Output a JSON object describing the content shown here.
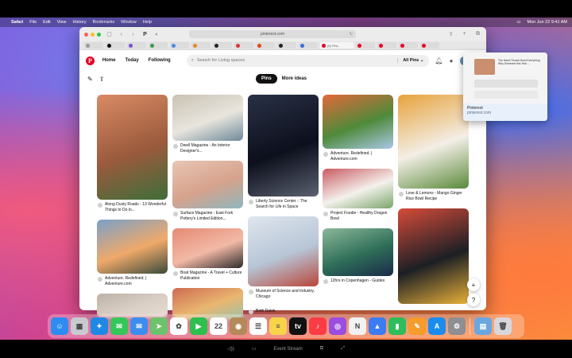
{
  "menubar": {
    "app_name": "Safari",
    "items": [
      "File",
      "Edit",
      "View",
      "History",
      "Bookmarks",
      "Window",
      "Help"
    ],
    "datetime": "Mon Jun 22  9:41 AM"
  },
  "browser": {
    "address": "pinterest.com",
    "active_tab_label": "(6) Pint..."
  },
  "pinterest": {
    "nav": {
      "home": "Home",
      "today": "Today",
      "following": "Following"
    },
    "search_placeholder": "Search for Living spaces",
    "search_scope": "All Pins",
    "tabs": {
      "pins": "Pins",
      "more_ideas": "More ideas"
    },
    "columns": [
      [
        {
          "caption": "Along Dusty Roads - 13 Wonderful Things to Do in...",
          "palette": [
            "#9a5a3c",
            "#d98b64",
            "#3e6e3a"
          ],
          "height": 132
        },
        {
          "caption": "Adventure. Redefined. | Adventure.com",
          "palette": [
            "#f0a96a",
            "#7aa0c8",
            "#3a4a3a"
          ],
          "height": 68
        },
        {
          "caption": "",
          "palette": [
            "#d9cfc4",
            "#bdb2a6",
            "#e7ded3"
          ],
          "height": 30
        }
      ],
      [
        {
          "caption": "Dwell Magazine - An Interior Designer's...",
          "palette": [
            "#e9e5dd",
            "#c9c2b4",
            "#6d8a9a"
          ],
          "height": 58
        },
        {
          "caption": "Surface Magazine - East Fork Pottery's Limited Edition...",
          "palette": [
            "#d6a28c",
            "#e8c6b4",
            "#8fb6bd"
          ],
          "height": 60
        },
        {
          "caption": "Boat Magazine - A Travel + Culture Publication",
          "palette": [
            "#f2b9a6",
            "#e58a74",
            "#2d2a2a"
          ],
          "height": 50
        },
        {
          "caption": "",
          "palette": [
            "#e9b770",
            "#cf6b52",
            "#9bc0a9"
          ],
          "height": 40
        }
      ],
      [
        {
          "caption": "Liberty Science Center :: The Search for Life in Space",
          "palette": [
            "#0c0f1c",
            "#2a3146",
            "#5b6170"
          ],
          "height": 128
        },
        {
          "caption": "Museum of Science and Industry, Chicago",
          "palette": [
            "#b7c5d6",
            "#dfe6ee",
            "#b8463a"
          ],
          "height": 88
        },
        {
          "caption": "Beth Dakin",
          "palette": [],
          "height": 0
        }
      ],
      [
        {
          "caption": "Adventure. Redefined. | Adventure.com",
          "palette": [
            "#4f8a3a",
            "#e2693a",
            "#a9c8e6"
          ],
          "height": 68
        },
        {
          "caption": "Project Foodie - Healthy Dragon Bowl",
          "palette": [
            "#f4f1ec",
            "#c95b62",
            "#7aa56a"
          ],
          "height": 50
        },
        {
          "caption": "12hrs in Copenhagen - Guides",
          "palette": [
            "#2e6e58",
            "#8cb89a",
            "#1a2a4a"
          ],
          "height": 60
        }
      ],
      [
        {
          "caption": "Love & Lemons - Mango Ginger Rice Bowl Recipe",
          "palette": [
            "#f3eee6",
            "#e7a23c",
            "#5a8a3a"
          ],
          "height": 118
        },
        {
          "caption": "",
          "palette": [
            "#1c1f24",
            "#d64b3a",
            "#e8b03a"
          ],
          "height": 120
        }
      ]
    ],
    "popup": {
      "title": "Pinterest",
      "site": "pinterest.com",
      "headline": "The Hand-Thrown Bowl Everything Why Someone this Year ..."
    },
    "fab_add": "+",
    "fab_help": "?"
  },
  "dock": {
    "items": [
      {
        "name": "finder-icon",
        "color": "#2d8cf0",
        "glyph": "☺"
      },
      {
        "name": "launchpad-icon",
        "color": "#c9c9d0",
        "glyph": "▦"
      },
      {
        "name": "safari-icon",
        "color": "#1e88e5",
        "glyph": "✦"
      },
      {
        "name": "messages-icon",
        "color": "#34c759",
        "glyph": "✉"
      },
      {
        "name": "mail-icon",
        "color": "#3b8ef0",
        "glyph": "✉"
      },
      {
        "name": "maps-icon",
        "color": "#6dc26d",
        "glyph": "➤"
      },
      {
        "name": "photos-icon",
        "color": "#ffffff",
        "glyph": "✿"
      },
      {
        "name": "facetime-icon",
        "color": "#2fbf4f",
        "glyph": "▶"
      },
      {
        "name": "calendar-icon",
        "color": "#ffffff",
        "glyph": "22"
      },
      {
        "name": "contacts-icon",
        "color": "#b58a5a",
        "glyph": "◉"
      },
      {
        "name": "reminders-icon",
        "color": "#ffffff",
        "glyph": "☰"
      },
      {
        "name": "notes-icon",
        "color": "#f7d44a",
        "glyph": "≡"
      },
      {
        "name": "tv-icon",
        "color": "#111111",
        "glyph": "tv"
      },
      {
        "name": "music-icon",
        "color": "#fc3c44",
        "glyph": "♪"
      },
      {
        "name": "podcasts-icon",
        "color": "#9b4de0",
        "glyph": "◎"
      },
      {
        "name": "news-icon",
        "color": "#f2f2f2",
        "glyph": "N"
      },
      {
        "name": "keynote-icon",
        "color": "#3d7bf0",
        "glyph": "▲"
      },
      {
        "name": "numbers-icon",
        "color": "#2dbd5a",
        "glyph": "▮"
      },
      {
        "name": "pages-icon",
        "color": "#f59c2a",
        "glyph": "✎"
      },
      {
        "name": "app-store-icon",
        "color": "#1a8cf0",
        "glyph": "A"
      },
      {
        "name": "system-preferences-icon",
        "color": "#8e8e93",
        "glyph": "⚙"
      }
    ],
    "trailing": [
      {
        "name": "downloads-folder-icon",
        "color": "#6aa7e0",
        "glyph": "▤"
      },
      {
        "name": "trash-icon",
        "color": "#d8d8dc",
        "glyph": "🗑"
      }
    ]
  },
  "bottom_bar": {
    "label": "Event Stream"
  }
}
